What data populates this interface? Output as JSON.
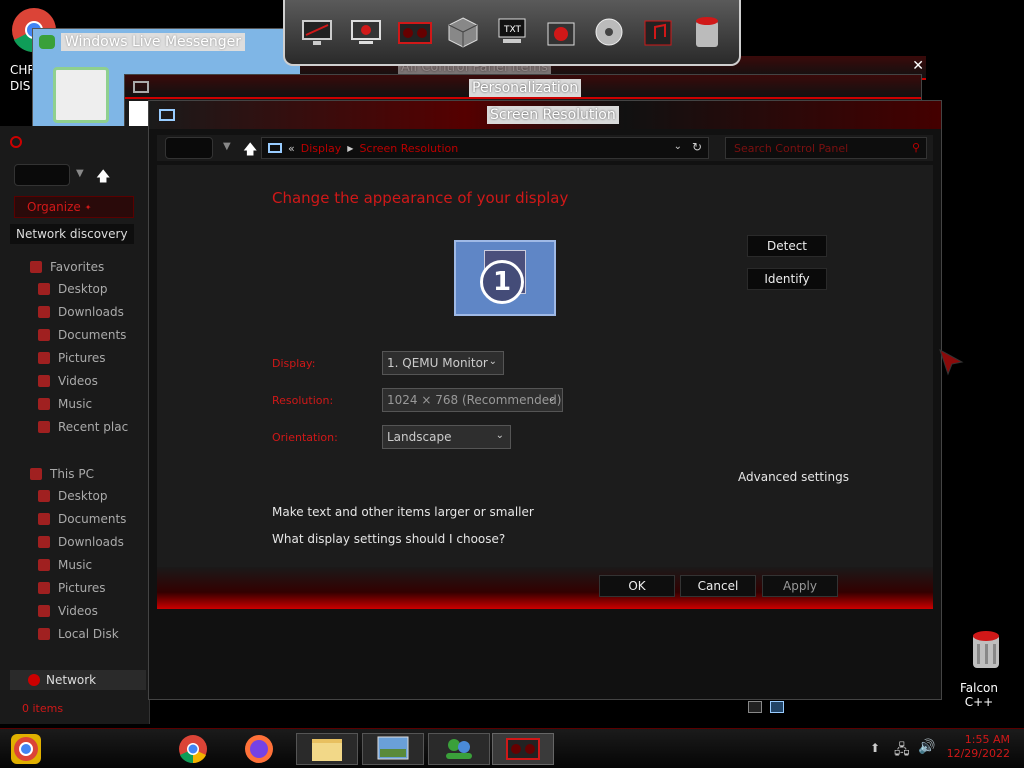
{
  "desktop": {
    "icons": [
      {
        "label": "CHR DIS",
        "icon": "chrome-icon"
      },
      {
        "label": "Falcon C++",
        "icon": "red-bucket-icon"
      }
    ]
  },
  "dock": {
    "items": [
      "display-icon",
      "monitor-settings-icon",
      "graphics-card-icon",
      "box-icon",
      "txt-file-icon",
      "folder-red-icon",
      "disk-icon",
      "music-folder-icon",
      "recycle-bin-icon"
    ]
  },
  "background_windows": {
    "messenger_title": "Windows Live Messenger",
    "personalization_title": "Personalization",
    "all_control_panel_title": "All Control Panel Items"
  },
  "explorer": {
    "organize_label": "Organize",
    "network_discovery": "Network discovery",
    "favorites_label": "Favorites",
    "favorites_items": [
      "Desktop",
      "Downloads",
      "Documents",
      "Pictures",
      "Videos",
      "Music",
      "Recent plac"
    ],
    "this_pc_label": "This PC",
    "this_pc_items": [
      "Desktop",
      "Documents",
      "Downloads",
      "Music",
      "Pictures",
      "Videos",
      "Local Disk"
    ],
    "network_label": "Network",
    "status": "0 items"
  },
  "main_window": {
    "title": "Screen Resolution",
    "breadcrumb": [
      "Display",
      "Screen Resolution"
    ],
    "breadcrumb_prefix": "«",
    "search_placeholder": "Search Control Panel",
    "heading": "Change the appearance of your display",
    "monitor_number": "1",
    "detect_label": "Detect",
    "identify_label": "Identify",
    "display_label": "Display:",
    "display_value": "1. QEMU Monitor",
    "resolution_label": "Resolution:",
    "resolution_value": "1024 × 768 (Recommended)",
    "orientation_label": "Orientation:",
    "orientation_value": "Landscape",
    "advanced_settings": "Advanced settings",
    "link_text_size": "Make text and other items larger or smaller",
    "link_which_settings": "What display settings should I choose?",
    "ok_label": "OK",
    "cancel_label": "Cancel",
    "apply_label": "Apply"
  },
  "taskbar": {
    "time": "1:55 AM",
    "date": "12/29/2022"
  },
  "colors": {
    "accent_red": "#d01818",
    "background": "#000000"
  }
}
